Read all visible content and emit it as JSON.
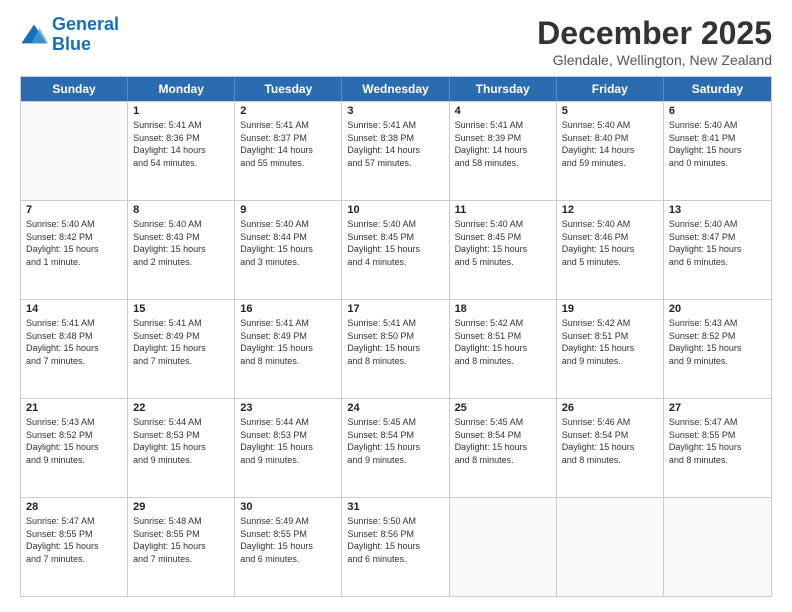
{
  "logo": {
    "line1": "General",
    "line2": "Blue"
  },
  "title": "December 2025",
  "subtitle": "Glendale, Wellington, New Zealand",
  "weekdays": [
    "Sunday",
    "Monday",
    "Tuesday",
    "Wednesday",
    "Thursday",
    "Friday",
    "Saturday"
  ],
  "weeks": [
    [
      {
        "day": "",
        "info": ""
      },
      {
        "day": "1",
        "info": "Sunrise: 5:41 AM\nSunset: 8:36 PM\nDaylight: 14 hours\nand 54 minutes."
      },
      {
        "day": "2",
        "info": "Sunrise: 5:41 AM\nSunset: 8:37 PM\nDaylight: 14 hours\nand 55 minutes."
      },
      {
        "day": "3",
        "info": "Sunrise: 5:41 AM\nSunset: 8:38 PM\nDaylight: 14 hours\nand 57 minutes."
      },
      {
        "day": "4",
        "info": "Sunrise: 5:41 AM\nSunset: 8:39 PM\nDaylight: 14 hours\nand 58 minutes."
      },
      {
        "day": "5",
        "info": "Sunrise: 5:40 AM\nSunset: 8:40 PM\nDaylight: 14 hours\nand 59 minutes."
      },
      {
        "day": "6",
        "info": "Sunrise: 5:40 AM\nSunset: 8:41 PM\nDaylight: 15 hours\nand 0 minutes."
      }
    ],
    [
      {
        "day": "7",
        "info": "Sunrise: 5:40 AM\nSunset: 8:42 PM\nDaylight: 15 hours\nand 1 minute."
      },
      {
        "day": "8",
        "info": "Sunrise: 5:40 AM\nSunset: 8:43 PM\nDaylight: 15 hours\nand 2 minutes."
      },
      {
        "day": "9",
        "info": "Sunrise: 5:40 AM\nSunset: 8:44 PM\nDaylight: 15 hours\nand 3 minutes."
      },
      {
        "day": "10",
        "info": "Sunrise: 5:40 AM\nSunset: 8:45 PM\nDaylight: 15 hours\nand 4 minutes."
      },
      {
        "day": "11",
        "info": "Sunrise: 5:40 AM\nSunset: 8:45 PM\nDaylight: 15 hours\nand 5 minutes."
      },
      {
        "day": "12",
        "info": "Sunrise: 5:40 AM\nSunset: 8:46 PM\nDaylight: 15 hours\nand 5 minutes."
      },
      {
        "day": "13",
        "info": "Sunrise: 5:40 AM\nSunset: 8:47 PM\nDaylight: 15 hours\nand 6 minutes."
      }
    ],
    [
      {
        "day": "14",
        "info": "Sunrise: 5:41 AM\nSunset: 8:48 PM\nDaylight: 15 hours\nand 7 minutes."
      },
      {
        "day": "15",
        "info": "Sunrise: 5:41 AM\nSunset: 8:49 PM\nDaylight: 15 hours\nand 7 minutes."
      },
      {
        "day": "16",
        "info": "Sunrise: 5:41 AM\nSunset: 8:49 PM\nDaylight: 15 hours\nand 8 minutes."
      },
      {
        "day": "17",
        "info": "Sunrise: 5:41 AM\nSunset: 8:50 PM\nDaylight: 15 hours\nand 8 minutes."
      },
      {
        "day": "18",
        "info": "Sunrise: 5:42 AM\nSunset: 8:51 PM\nDaylight: 15 hours\nand 8 minutes."
      },
      {
        "day": "19",
        "info": "Sunrise: 5:42 AM\nSunset: 8:51 PM\nDaylight: 15 hours\nand 9 minutes."
      },
      {
        "day": "20",
        "info": "Sunrise: 5:43 AM\nSunset: 8:52 PM\nDaylight: 15 hours\nand 9 minutes."
      }
    ],
    [
      {
        "day": "21",
        "info": "Sunrise: 5:43 AM\nSunset: 8:52 PM\nDaylight: 15 hours\nand 9 minutes."
      },
      {
        "day": "22",
        "info": "Sunrise: 5:44 AM\nSunset: 8:53 PM\nDaylight: 15 hours\nand 9 minutes."
      },
      {
        "day": "23",
        "info": "Sunrise: 5:44 AM\nSunset: 8:53 PM\nDaylight: 15 hours\nand 9 minutes."
      },
      {
        "day": "24",
        "info": "Sunrise: 5:45 AM\nSunset: 8:54 PM\nDaylight: 15 hours\nand 9 minutes."
      },
      {
        "day": "25",
        "info": "Sunrise: 5:45 AM\nSunset: 8:54 PM\nDaylight: 15 hours\nand 8 minutes."
      },
      {
        "day": "26",
        "info": "Sunrise: 5:46 AM\nSunset: 8:54 PM\nDaylight: 15 hours\nand 8 minutes."
      },
      {
        "day": "27",
        "info": "Sunrise: 5:47 AM\nSunset: 8:55 PM\nDaylight: 15 hours\nand 8 minutes."
      }
    ],
    [
      {
        "day": "28",
        "info": "Sunrise: 5:47 AM\nSunset: 8:55 PM\nDaylight: 15 hours\nand 7 minutes."
      },
      {
        "day": "29",
        "info": "Sunrise: 5:48 AM\nSunset: 8:55 PM\nDaylight: 15 hours\nand 7 minutes."
      },
      {
        "day": "30",
        "info": "Sunrise: 5:49 AM\nSunset: 8:55 PM\nDaylight: 15 hours\nand 6 minutes."
      },
      {
        "day": "31",
        "info": "Sunrise: 5:50 AM\nSunset: 8:56 PM\nDaylight: 15 hours\nand 6 minutes."
      },
      {
        "day": "",
        "info": ""
      },
      {
        "day": "",
        "info": ""
      },
      {
        "day": "",
        "info": ""
      }
    ]
  ]
}
